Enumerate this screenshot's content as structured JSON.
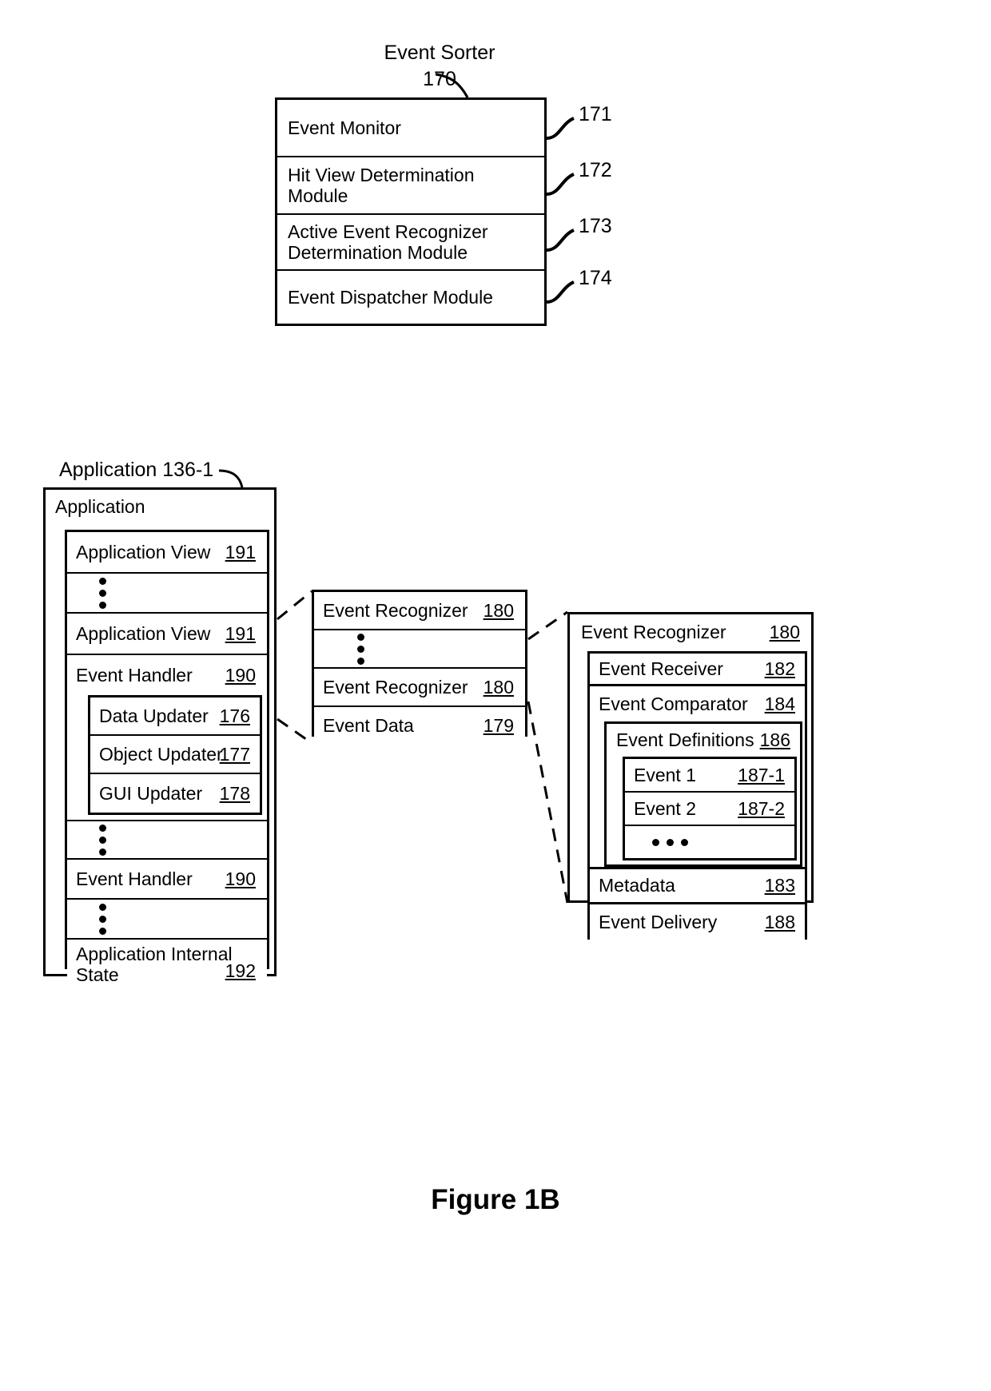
{
  "figure": {
    "caption": "Figure 1B"
  },
  "event_sorter": {
    "title": "Event Sorter",
    "ref": "170",
    "rows": [
      {
        "label": "Event Monitor",
        "ref": "171"
      },
      {
        "label": "Hit View Determination\nModule",
        "ref": "172"
      },
      {
        "label": "Active Event Recognizer\nDetermination Module",
        "ref": "173"
      },
      {
        "label": "Event Dispatcher Module",
        "ref": "174"
      }
    ]
  },
  "application": {
    "caption": "Application 136-1",
    "title": "Application",
    "rows": [
      {
        "type": "item",
        "label": "Application View",
        "ref": "191"
      },
      {
        "type": "vdots"
      },
      {
        "type": "item",
        "label": "Application View",
        "ref": "191"
      },
      {
        "type": "item",
        "label": "Event Handler",
        "ref": "190"
      }
    ],
    "event_handler_children": [
      {
        "label": "Data Updater",
        "ref": "176"
      },
      {
        "label": "Object Updater",
        "ref": "177"
      },
      {
        "label": "GUI Updater",
        "ref": "178"
      }
    ],
    "rows_after": [
      {
        "type": "vdots"
      },
      {
        "type": "item",
        "label": "Event Handler",
        "ref": "190"
      },
      {
        "type": "vdots"
      },
      {
        "type": "item",
        "label": "Application Internal\nState",
        "ref": "192"
      }
    ]
  },
  "event_recognizer_list": {
    "rows": [
      {
        "type": "item",
        "label": "Event Recognizer",
        "ref": "180"
      },
      {
        "type": "vdots"
      },
      {
        "type": "item",
        "label": "Event Recognizer",
        "ref": "180"
      },
      {
        "type": "item",
        "label": "Event Data",
        "ref": "179"
      }
    ]
  },
  "event_recognizer_detail": {
    "title": "Event Recognizer",
    "ref": "180",
    "rows": [
      {
        "label": "Event Receiver",
        "ref": "182"
      },
      {
        "label": "Event Comparator",
        "ref": "184"
      }
    ],
    "event_definitions": {
      "title": "Event Definitions",
      "ref": "186",
      "rows": [
        {
          "type": "item",
          "label": "Event 1",
          "ref": "187-1"
        },
        {
          "type": "item",
          "label": "Event 2",
          "ref": "187-2"
        },
        {
          "type": "hdots"
        }
      ]
    },
    "rows_after": [
      {
        "label": "Metadata",
        "ref": "183"
      },
      {
        "label": "Event Delivery",
        "ref": "188"
      }
    ]
  }
}
